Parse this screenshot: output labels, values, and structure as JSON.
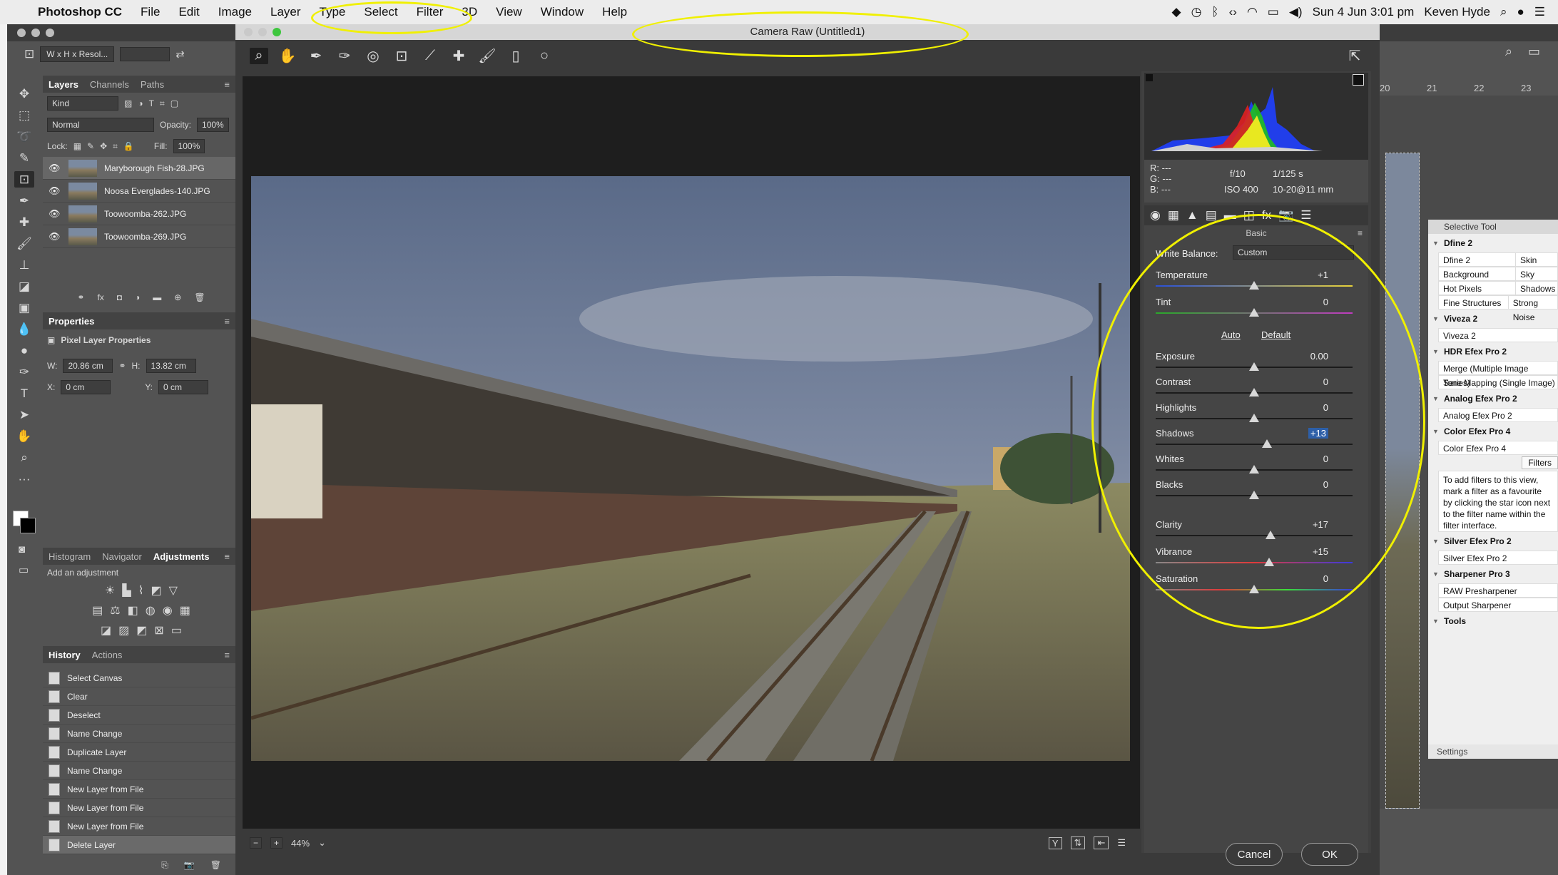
{
  "menubar": {
    "app": "Photoshop CC",
    "items": [
      "File",
      "Edit",
      "Image",
      "Layer",
      "Type",
      "Select",
      "Filter",
      "3D",
      "View",
      "Window",
      "Help"
    ],
    "datetime": "Sun 4 Jun  3:01 pm",
    "user": "Keven Hyde"
  },
  "options": {
    "ratio": "W x H x Resol..."
  },
  "layers_panel": {
    "tabs": [
      "Layers",
      "Channels",
      "Paths"
    ],
    "kind": "Kind",
    "blend": "Normal",
    "opacity_label": "Opacity:",
    "opacity": "100%",
    "lock_label": "Lock:",
    "fill_label": "Fill:",
    "fill": "100%",
    "layers": [
      "Maryborough Fish-28.JPG",
      "Noosa Everglades-140.JPG",
      "Toowoomba-262.JPG",
      "Toowoomba-269.JPG"
    ]
  },
  "properties": {
    "title": "Properties",
    "subtitle": "Pixel Layer Properties",
    "w_label": "W:",
    "w": "20.86 cm",
    "h_label": "H:",
    "h": "13.82 cm",
    "x_label": "X:",
    "x": "0 cm",
    "y_label": "Y:",
    "y": "0 cm"
  },
  "adjust": {
    "tabs": [
      "Histogram",
      "Navigator",
      "Adjustments"
    ],
    "title": "Add an adjustment"
  },
  "history": {
    "tabs": [
      "History",
      "Actions"
    ],
    "items": [
      "Select Canvas",
      "Clear",
      "Deselect",
      "Name Change",
      "Duplicate Layer",
      "Name Change",
      "New Layer from File",
      "New Layer from File",
      "New Layer from File",
      "Delete Layer"
    ]
  },
  "camera_raw": {
    "title": "Camera Raw (Untitled1)",
    "zoom": "44%",
    "cancel": "Cancel",
    "ok": "OK"
  },
  "exif": {
    "r": "R:",
    "g": "G:",
    "b": "B:",
    "dash": "---",
    "aperture": "f/10",
    "shutter": "1/125 s",
    "iso": "ISO 400",
    "lens": "10-20@11 mm"
  },
  "basic": {
    "title": "Basic",
    "wb_label": "White Balance:",
    "wb_value": "Custom",
    "auto": "Auto",
    "default": "Default",
    "sliders": [
      {
        "label": "Temperature",
        "value": "+1",
        "pos": 0.5
      },
      {
        "label": "Tint",
        "value": "0",
        "pos": 0.5
      },
      {
        "label": "Exposure",
        "value": "0.00",
        "pos": 0.5
      },
      {
        "label": "Contrast",
        "value": "0",
        "pos": 0.5
      },
      {
        "label": "Highlights",
        "value": "0",
        "pos": 0.5
      },
      {
        "label": "Shadows",
        "value": "+13",
        "pos": 0.565
      },
      {
        "label": "Whites",
        "value": "0",
        "pos": 0.5
      },
      {
        "label": "Blacks",
        "value": "0",
        "pos": 0.5
      },
      {
        "label": "Clarity",
        "value": "+17",
        "pos": 0.585
      },
      {
        "label": "Vibrance",
        "value": "+15",
        "pos": 0.575
      },
      {
        "label": "Saturation",
        "value": "0",
        "pos": 0.5
      }
    ]
  },
  "ruler": [
    "20",
    "21",
    "22",
    "23"
  ],
  "selective": {
    "title": "Selective Tool",
    "settings": "Settings",
    "filters_btn": "Filters",
    "sections": [
      {
        "name": "Dfine 2",
        "rows": [
          [
            "Dfine 2",
            "Skin"
          ],
          [
            "Background",
            "Sky"
          ],
          [
            "Hot Pixels",
            "Shadows"
          ],
          [
            "Fine Structures",
            "Strong Noise"
          ]
        ]
      },
      {
        "name": "Viveza 2",
        "items": [
          "Viveza 2"
        ]
      },
      {
        "name": "HDR Efex Pro 2",
        "items": [
          "Merge (Multiple Image Series)",
          "Tone Mapping (Single Image)"
        ]
      },
      {
        "name": "Analog Efex Pro 2",
        "items": [
          "Analog Efex Pro 2"
        ]
      },
      {
        "name": "Color Efex Pro 4",
        "items": [
          "Color Efex Pro 4"
        ]
      },
      {
        "name": "Silver Efex Pro 2",
        "items": [
          "Silver Efex Pro 2"
        ]
      },
      {
        "name": "Sharpener Pro 3",
        "items": [
          "RAW Presharpener",
          "Output Sharpener"
        ]
      },
      {
        "name": "Tools",
        "items": []
      }
    ],
    "note": "To add filters to this view, mark a filter as a favourite by clicking the star icon next to the filter name within the filter interface."
  }
}
